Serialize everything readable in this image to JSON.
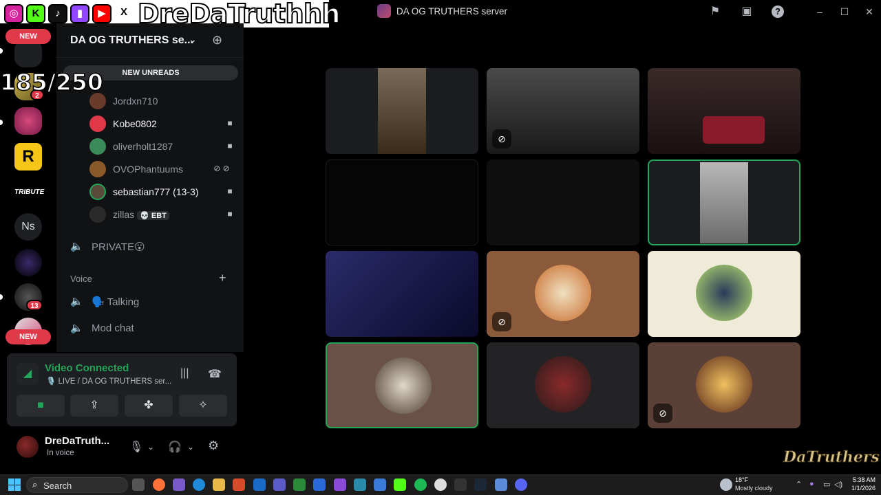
{
  "window": {
    "title": "DA OG TRUTHERS server",
    "icons": [
      "flag-icon",
      "inbox-icon",
      "help-icon"
    ]
  },
  "overlay": {
    "channel_name": "DreDaTruthhh",
    "counter": "185/250",
    "socials": [
      "instagram-icon",
      "kick-icon",
      "tiktok-icon",
      "twitch-icon",
      "youtube-icon",
      "x-icon"
    ],
    "watermark": "DaTruthers"
  },
  "rail": {
    "new_label": "NEW",
    "badge_a": "2",
    "badge_b": "13",
    "ns_label": "Ns",
    "tribute_label": "TRIBUTE"
  },
  "server": {
    "name": "DA OG TRUTHERS se...",
    "new_unreads": "NEW UNREADS"
  },
  "members": [
    {
      "name": "Jordxn710",
      "icon": ""
    },
    {
      "name": "Kobe0802",
      "icon": "video-icon",
      "highlight": true
    },
    {
      "name": "oliverholt1287",
      "icon": "video-icon"
    },
    {
      "name": "OVOPhantuums",
      "icon": "muted-deafened-icon"
    },
    {
      "name": "sebastian777 (13-3)",
      "icon": "video-icon",
      "highlight": true
    },
    {
      "name": "zillas",
      "tag": "💀 EBT",
      "icon": "video-icon"
    }
  ],
  "channels": {
    "private": "PRIVATE😮",
    "voice_category": "Voice",
    "talking": "🗣️ Talking",
    "mod_chat": "Mod chat"
  },
  "voice": {
    "status": "Video Connected",
    "sub": "🎙️ LIVE / DA OG TRUTHERS ser..."
  },
  "user": {
    "name": "DreDaTruth...",
    "status": "In voice"
  },
  "taskbar": {
    "search": "Search",
    "temp": "18°F",
    "weather": "Mostly cloudy",
    "time": "5:38 AM",
    "date": "1/1/2026"
  },
  "colors": {
    "accent_green": "#23a55a",
    "mention_red": "#e03a4a",
    "bg": "#000000"
  }
}
